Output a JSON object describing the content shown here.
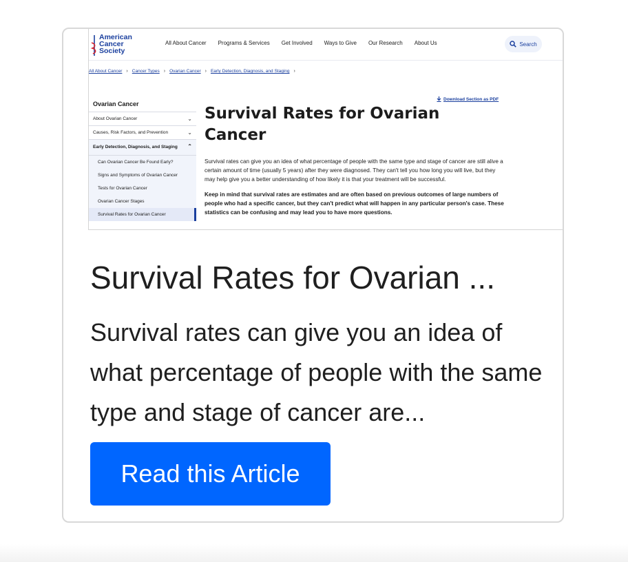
{
  "screenshot": {
    "logo": {
      "line1": "American",
      "line2": "Cancer",
      "line3": "Society"
    },
    "nav": [
      "All About Cancer",
      "Programs & Services",
      "Get Involved",
      "Ways to Give",
      "Our Research",
      "About Us"
    ],
    "search_label": "Search",
    "breadcrumb": [
      "All About Cancer",
      "Cancer Types",
      "Ovarian Cancer",
      "Early Detection, Diagnosis, and Staging"
    ],
    "sidebar": {
      "title": "Ovarian Cancer",
      "items": [
        "About Ovarian Cancer",
        "Causes, Risk Factors, and Prevention"
      ],
      "expanded": "Early Detection, Diagnosis, and Staging",
      "subitems": [
        "Can Ovarian Cancer Be Found Early?",
        "Signs and Symptoms of Ovarian Cancer",
        "Tests for Ovarian Cancer",
        "Ovarian Cancer Stages",
        "Survival Rates for Ovarian Cancer"
      ]
    },
    "pdf_link": "Download Section as PDF",
    "title": "Survival Rates for Ovarian Cancer",
    "para1": "Survival rates can give you an idea of what percentage of people with the same type and stage of cancer are still alive a certain amount of time (usually 5 years) after they were diagnosed. They can't tell you how long you will live, but they may help give you a better understanding of how likely it is that your treatment will be successful.",
    "para2": "Keep in mind that survival rates are estimates and are often based on previous outcomes of large numbers of people who had a specific cancer, but they can't predict what will happen in any particular person's case. These statistics can be confusing and may lead you to have more questions."
  },
  "card": {
    "title": "Survival Rates for Ovarian ...",
    "description": "Survival rates can give you an idea of what percentage of people with the same type and stage of cancer are...",
    "cta_label": "Read this Article"
  },
  "colors": {
    "cta": "#0066ff",
    "brand": "#1a3f9e"
  }
}
